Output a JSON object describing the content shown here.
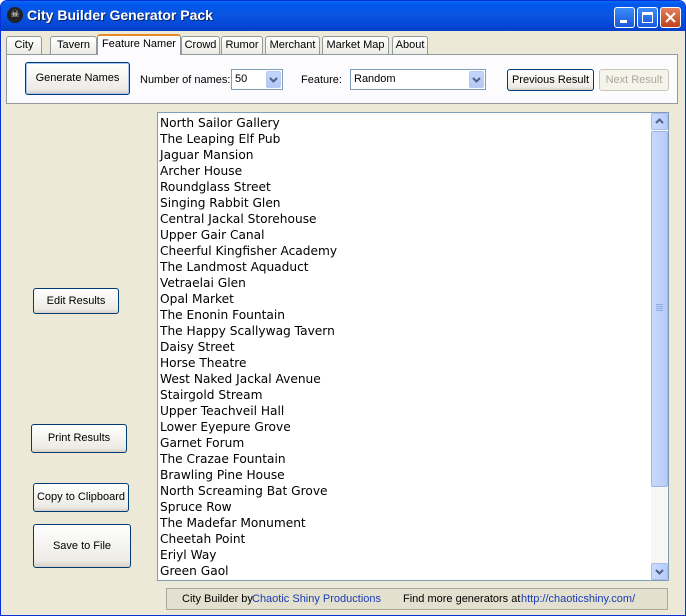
{
  "window": {
    "title": "City Builder Generator Pack",
    "icon": "app-skull-icon"
  },
  "tabs": [
    {
      "label": "City",
      "active": false
    },
    {
      "label": "Tavern",
      "active": false
    },
    {
      "label": "Feature Namer",
      "active": true
    },
    {
      "label": "Crowd",
      "active": false
    },
    {
      "label": "Rumor",
      "active": false
    },
    {
      "label": "Merchant",
      "active": false
    },
    {
      "label": "Market Map",
      "active": false
    },
    {
      "label": "About",
      "active": false
    }
  ],
  "toolbar": {
    "generate_label": "Generate Names",
    "count_label": "Number of names:",
    "count_value": "50",
    "feature_label": "Feature:",
    "feature_value": "Random",
    "previous_label": "Previous Result",
    "next_label": "Next Result"
  },
  "side_buttons": {
    "edit": "Edit Results",
    "print": "Print Results",
    "copy": "Copy to Clipboard",
    "save": "Save to File"
  },
  "results": [
    "North Sailor Gallery",
    "The Leaping Elf Pub",
    "Jaguar Mansion",
    "Archer House",
    "Roundglass Street",
    "Singing Rabbit Glen",
    "Central Jackal Storehouse",
    "Upper Gair Canal",
    "Cheerful Kingfisher Academy",
    "The Landmost Aquaduct",
    "Vetraelai Glen",
    "Opal Market",
    "The Enonin Fountain",
    "The Happy Scallywag Tavern",
    "Daisy Street",
    "Horse Theatre",
    "West Naked Jackal Avenue",
    "Stairgold Stream",
    "Upper Teachveil Hall",
    "Lower Eyepure Grove",
    "Garnet Forum",
    "The Crazae Fountain",
    "Brawling Pine House",
    "North Screaming Bat Grove",
    "Spruce Row",
    "The Madefar Monument",
    "Cheetah Point",
    "Eriyl Way",
    "Green Gaol"
  ],
  "status": {
    "prefix": "City Builder by",
    "company": "Chaotic Shiny Productions",
    "more": "Find more generators at",
    "url": "http://chaoticshiny.com/"
  },
  "colors": {
    "titlebar": "#0058ee",
    "link": "#1a3cb4",
    "active_tab_accent": "#e68b2c"
  }
}
